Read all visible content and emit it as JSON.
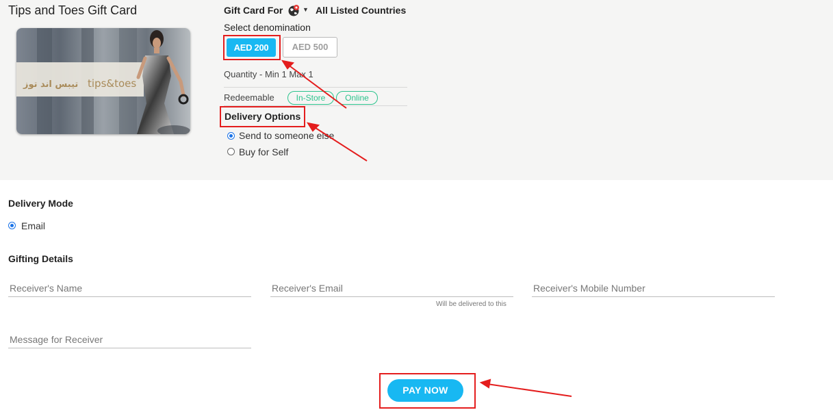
{
  "product": {
    "title": "Tips and Toes Gift Card",
    "card_logo_arabic": "تيبس اند توز",
    "card_logo_latin": "tips&toes"
  },
  "gift_for": {
    "label": "Gift Card For",
    "country": "All Listed Countries",
    "icon": "globe-icon"
  },
  "denomination": {
    "label": "Select denomination",
    "options": [
      "AED 200",
      "AED 500"
    ],
    "selected": "AED 200"
  },
  "quantity": "Quantity - Min 1 Max 1",
  "redeemable": {
    "label": "Redeemable",
    "tags": [
      "In-Store",
      "Online"
    ]
  },
  "delivery_options": {
    "label": "Delivery Options",
    "options": [
      "Send to someone else",
      "Buy for Self"
    ],
    "selected": "Send to someone else"
  },
  "delivery_mode": {
    "label": "Delivery Mode",
    "option": "Email"
  },
  "gifting": {
    "label": "Gifting Details",
    "receiver_name_placeholder": "Receiver's Name",
    "receiver_email_placeholder": "Receiver's Email",
    "receiver_email_hint": "Will be delivered to this",
    "receiver_mobile_placeholder": "Receiver's Mobile Number",
    "message_placeholder": "Message for Receiver"
  },
  "pay_label": "PAY NOW",
  "colors": {
    "accent": "#18b8f2",
    "annotation": "#e41d1d",
    "tag": "#2bc38c",
    "panel": "#f5f5f4"
  }
}
